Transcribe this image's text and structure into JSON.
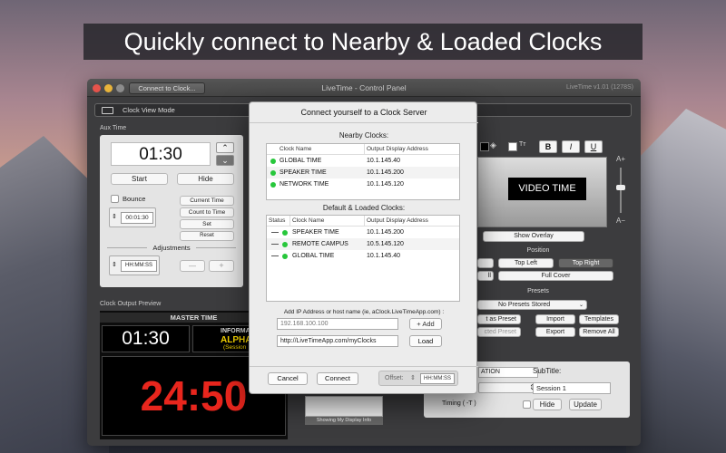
{
  "headline": "Quickly connect to Nearby  & Loaded Clocks",
  "window": {
    "connect_button": "Connect to Clock...",
    "title": "LiveTime - Control Panel",
    "version": "LiveTime v1.01 (1278S)"
  },
  "mode_bar": {
    "label": "Clock View Mode"
  },
  "aux": {
    "section": "Aux Time",
    "time": "01:30",
    "up": "⌃",
    "down": "⌄",
    "start": "Start",
    "hide": "Hide",
    "bounce": "Bounce",
    "current_time": "Current Time",
    "count_to_time": "Count to Time",
    "duration": "00:01:30",
    "set": "Set",
    "reset": "Reset",
    "adjustments": "Adjustments",
    "adj_field": "HH:MM:SS",
    "minus": "—",
    "plus": "+"
  },
  "preview": {
    "section": "Clock Output Preview",
    "title": "MASTER TIME",
    "aux_time": "01:30",
    "info_a": "INFORMATI",
    "info_b": "ALPHA",
    "info_c": "(Session",
    "main_time": "24:50"
  },
  "formatting": {
    "size_icon": "Tт",
    "bold": "B",
    "italic": "I",
    "underline": "U",
    "plus": "A+",
    "minus": "A−"
  },
  "overlay": {
    "video_time": "VIDEO TIME",
    "show_overlay": "Show Overlay",
    "position": "Position",
    "top_left": "Top Left",
    "top_right": "Top Right",
    "full_cover": "Full Cover",
    "partial_left": "ll",
    "presets": "Presets",
    "no_presets": "No Presets Stored",
    "save_preset": "t as Preset",
    "import": "Import",
    "templates": "Templates",
    "delete_preset": "cted Preset",
    "export": "Export",
    "remove_all": "Remove All"
  },
  "info_panel": {
    "label_partial": "ATION",
    "subtitle_label": "SubTitle:",
    "subtitle_value": "Session 1",
    "timing": "Timing ( -T )",
    "hide": "Hide",
    "update": "Update"
  },
  "showing_info": "Showing My Display Info",
  "dialog": {
    "title": "Connect yourself to a Clock Server",
    "nearby_title": "Nearby Clocks:",
    "nearby_headers": {
      "name": "Clock Name",
      "address": "Output Display Address"
    },
    "nearby": [
      {
        "name": "GLOBAL TIME",
        "address": "10.1.145.40"
      },
      {
        "name": "SPEAKER TIME",
        "address": "10.1.145.200"
      },
      {
        "name": "NETWORK TIME",
        "address": "10.1.145.120"
      }
    ],
    "loaded_title": "Default & Loaded Clocks:",
    "loaded_headers": {
      "status": "Status",
      "name": "Clock Name",
      "address": "Output Display Address"
    },
    "loaded": [
      {
        "name": "SPEAKER TIME",
        "address": "10.1.145.200"
      },
      {
        "name": "REMOTE CAMPUS",
        "address": "10.5.145.120"
      },
      {
        "name": "GLOBAL TIME",
        "address": "10.1.145.40"
      }
    ],
    "add_label": "Add IP Address or host name (ie, aClock.LiveTimeApp.com) :",
    "ip_placeholder": "192.168.100.100",
    "add_button": "+ Add",
    "url_value": "http://LiveTimeApp.com/myClocks",
    "load_button": "Load",
    "cancel": "Cancel",
    "connect": "Connect",
    "offset_label": "Offset:",
    "offset_field": "HH:MM:SS"
  },
  "colors": {
    "accent_red": "#e8261d",
    "status_green": "#27c73b",
    "info_yellow": "#f5d300"
  }
}
